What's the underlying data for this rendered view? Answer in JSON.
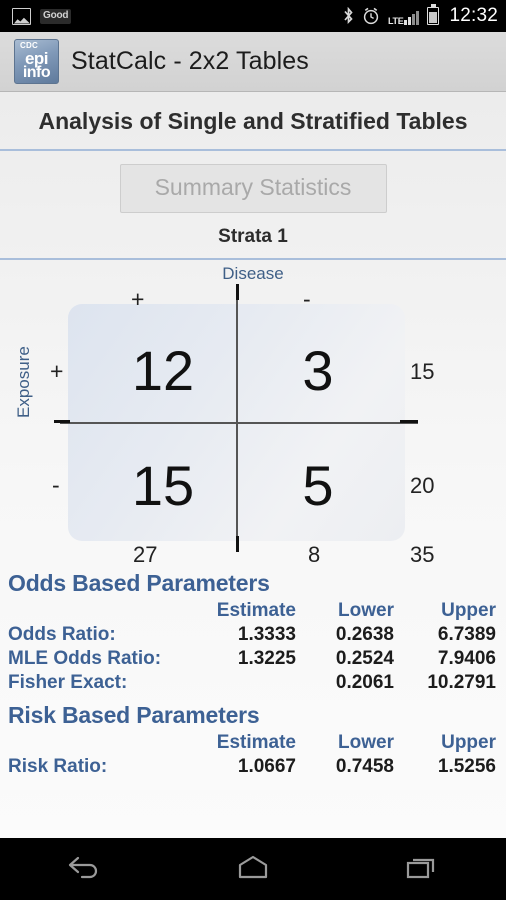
{
  "status_bar": {
    "left_icons": [
      "photo-icon",
      "good-badge"
    ],
    "good_badge": "Good",
    "right_icons": [
      "bluetooth-icon",
      "alarm-icon",
      "lte-icon",
      "signal-icon",
      "battery-icon"
    ],
    "lte_label": "LTE",
    "time": "12:32"
  },
  "app_bar": {
    "logo": {
      "cdc": "CDC",
      "epi": "epi",
      "info": "info",
      "tm": "™"
    },
    "title": "StatCalc - 2x2 Tables"
  },
  "page": {
    "heading": "Analysis of Single and Stratified Tables",
    "summary_button": "Summary Statistics",
    "summary_button_enabled": false,
    "strata_label": "Strata 1",
    "rule_color": "#a9bedb",
    "label_color": "#3f5f87",
    "heading_color": "#3d6194"
  },
  "table_2x2": {
    "col_axis_label": "Disease",
    "row_axis_label": "Exposure",
    "col_headers": [
      "+",
      "-"
    ],
    "row_headers": [
      "+",
      "-"
    ],
    "cells": [
      [
        "12",
        "3"
      ],
      [
        "15",
        "5"
      ]
    ],
    "row_totals": [
      "15",
      "20"
    ],
    "col_totals": [
      "27",
      "8"
    ],
    "grand_total": "35"
  },
  "odds_section": {
    "title": "Odds Based Parameters",
    "columns": [
      "Estimate",
      "Lower",
      "Upper"
    ],
    "rows": [
      {
        "label": "Odds Ratio:",
        "estimate": "1.3333",
        "lower": "0.2638",
        "upper": "6.7389"
      },
      {
        "label": "MLE Odds Ratio:",
        "estimate": "1.3225",
        "lower": "0.2524",
        "upper": "7.9406"
      },
      {
        "label": "Fisher Exact:",
        "estimate": "",
        "lower": "0.2061",
        "upper": "10.2791"
      }
    ]
  },
  "risk_section": {
    "title": "Risk Based Parameters",
    "columns": [
      "Estimate",
      "Lower",
      "Upper"
    ],
    "rows": [
      {
        "label": "Risk Ratio:",
        "estimate": "1.0667",
        "lower": "0.7458",
        "upper": "1.5256"
      }
    ]
  },
  "nav_bar": {
    "buttons": [
      "back-icon",
      "home-icon",
      "recents-icon"
    ]
  }
}
